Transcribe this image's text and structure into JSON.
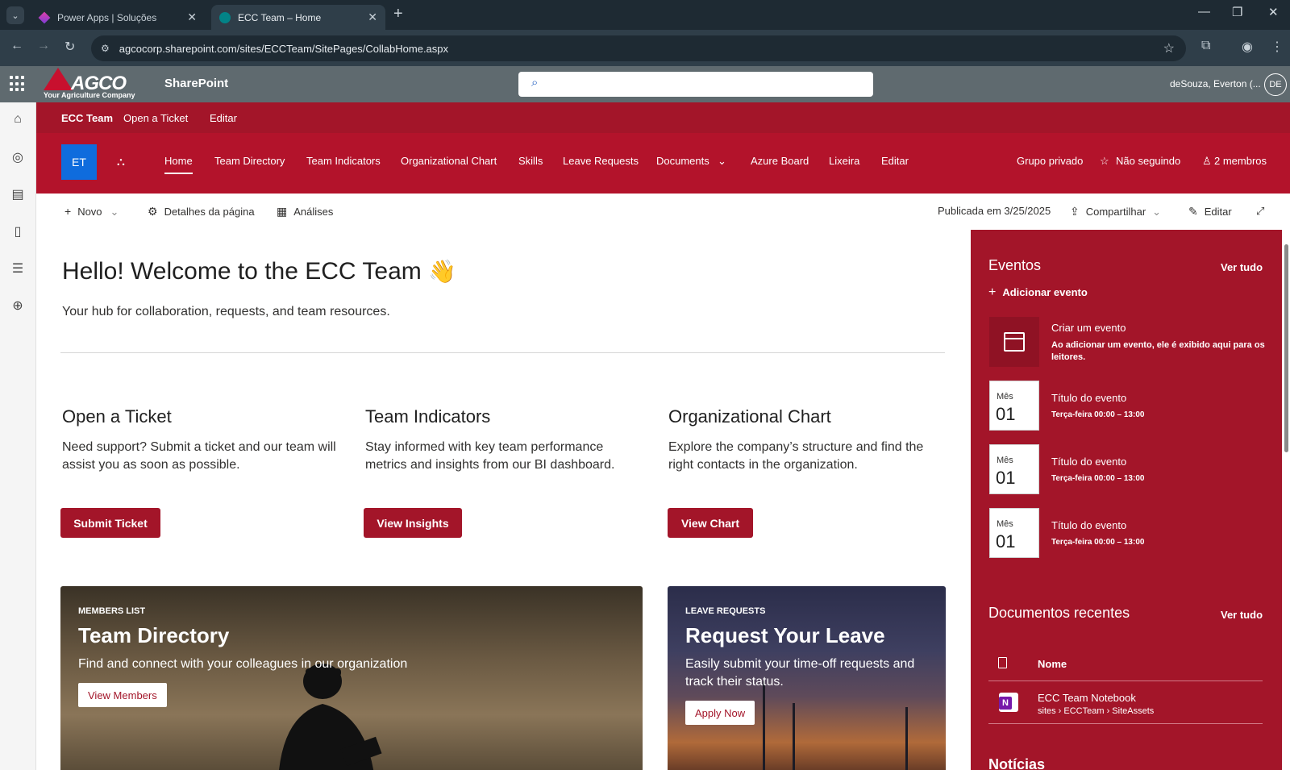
{
  "browser": {
    "tabs": [
      {
        "title": "Power Apps | Soluções",
        "active": false
      },
      {
        "title": "ECC Team – Home",
        "active": true
      }
    ],
    "url": "agcocorp.sharepoint.com/sites/ECCTeam/SitePages/CollabHome.aspx"
  },
  "suite": {
    "logo_word": "AGCO",
    "logo_tagline": "Your Agriculture Company",
    "app_name": "SharePoint",
    "user_name": "deSouza, Everton (...",
    "user_initials": "DE"
  },
  "hub_nav": [
    "ECC Team",
    "Open a Ticket",
    "Editar"
  ],
  "site": {
    "logo_initials": "ET",
    "nav": [
      "Home",
      "Team Directory",
      "Team Indicators",
      "Organizational Chart",
      "Skills",
      "Leave Requests",
      "Documents",
      "Azure Board",
      "Lixeira",
      "Editar"
    ],
    "privacy": "Grupo privado",
    "follow": "Não seguindo",
    "members": "2 membros"
  },
  "command_bar": {
    "new": "Novo",
    "page_details": "Detalhes da página",
    "analytics": "Análises",
    "published": "Publicada em 3/25/2025",
    "share": "Compartilhar",
    "edit": "Editar"
  },
  "main": {
    "title": "Hello! Welcome to the ECC Team",
    "emoji": "👋",
    "subtitle": "Your hub for collaboration, requests, and team resources.",
    "cards": [
      {
        "title": "Open a Ticket",
        "text": "Need support? Submit a ticket and our team will assist you as soon as possible.",
        "button": "Submit Ticket"
      },
      {
        "title": "Team Indicators",
        "text": "Stay informed with key team performance metrics and insights from our BI dashboard.",
        "button": "View Insights"
      },
      {
        "title": "Organizational Chart",
        "text": "Explore the company’s structure and find the right contacts in the organization.",
        "button": "View Chart"
      }
    ],
    "heroes": [
      {
        "eyebrow": "MEMBERS LIST",
        "title": "Team Directory",
        "text": "Find and connect with your colleagues in our organization",
        "button": "View Members"
      },
      {
        "eyebrow": "LEAVE REQUESTS",
        "title": "Request Your Leave",
        "text": "Easily submit your time-off requests and track their status.",
        "button": "Apply Now"
      }
    ]
  },
  "events": {
    "title": "Eventos",
    "see_all": "Ver tudo",
    "add": "Adicionar evento",
    "create_title": "Criar um evento",
    "create_desc": "Ao adicionar um evento, ele é exibido aqui para os leitores.",
    "items": [
      {
        "month": "Mês",
        "day": "01",
        "title": "Título do evento",
        "time": "Terça-feira 00:00 – 13:00"
      },
      {
        "month": "Mês",
        "day": "01",
        "title": "Título do evento",
        "time": "Terça-feira 00:00 – 13:00"
      },
      {
        "month": "Mês",
        "day": "01",
        "title": "Título do evento",
        "time": "Terça-feira 00:00 – 13:00"
      }
    ]
  },
  "recent_docs": {
    "title": "Documentos recentes",
    "see_all": "Ver tudo",
    "column": "Nome",
    "items": [
      {
        "name": "ECC Team Notebook",
        "path": "sites › ECCTeam › SiteAssets"
      }
    ]
  },
  "news": {
    "title": "Notícias"
  }
}
